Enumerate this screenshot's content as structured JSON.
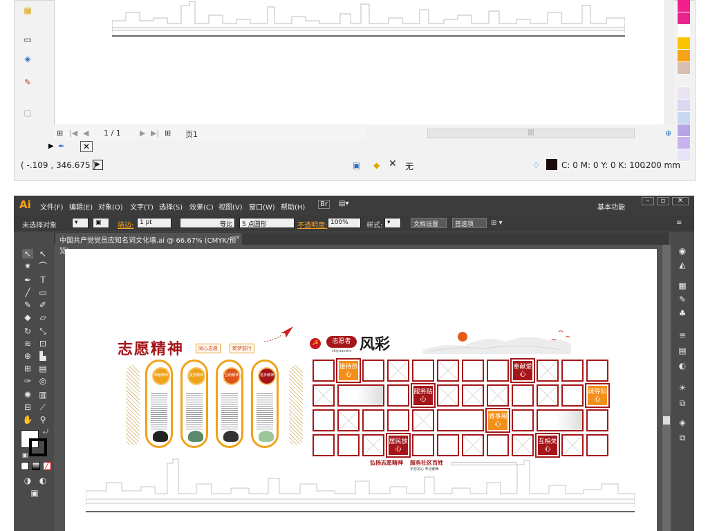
{
  "top_window": {
    "page_nav": {
      "page_counter": "1 / 1",
      "page_tab": "页1"
    },
    "status": {
      "coords": "( -.109 , 346.675 )",
      "fill_label": "无",
      "color_readout": "C: 0 M: 0 Y: 0 K: 100",
      "stroke_size": ".200 mm"
    },
    "scroll_thumb": "|||",
    "swatches": [
      "#f21f8a",
      "#e9238e",
      "#ffffff",
      "#fbc400",
      "#f7a21b",
      "#d8bfb1",
      "#f2f2f2",
      "#eae4f2",
      "#dcd6ee",
      "#c7d8f2",
      "#b6a6e6",
      "#c9b3ef",
      "#e8e4f6"
    ]
  },
  "ai_window": {
    "logo": "Ai",
    "menu": [
      "文件(F)",
      "编辑(E)",
      "对象(O)",
      "文字(T)",
      "选择(S)",
      "效果(C)",
      "视图(V)",
      "窗口(W)",
      "帮助(H)"
    ],
    "workspace": "基本功能",
    "control_bar": {
      "selection": "未选择对象",
      "stroke_label": "描边:",
      "stroke_weight": "1 pt",
      "stroke_style": "等比",
      "brush": "5 点圆形",
      "opacity_label": "不透明度:",
      "opacity": "100%",
      "style_label": "样式:",
      "doc_setup": "文档设置",
      "preferences": "首选项"
    },
    "document_tab": "中国共产党党员应知名词文化墙.ai @ 66.67% (CMYK/预览)"
  },
  "artwork": {
    "left_title": "志愿精神",
    "tags": [
      "同心志愿",
      "筑梦前行"
    ],
    "pillars": [
      {
        "heading": "奉献精神",
        "color": "#f0a21a"
      },
      {
        "heading": "友爱精神",
        "color": "#f0a21a"
      },
      {
        "heading": "互助精神",
        "color": "#e0541a"
      },
      {
        "heading": "进步精神",
        "color": "#a4161a"
      }
    ],
    "right_badge": "志愿者",
    "right_title": "风彩",
    "pinyin": "zhiyuanzhe",
    "grid_labels": [
      "接待热心",
      "奉献爱心",
      "服务贴心",
      "疏导知心",
      "做事用心",
      "居民放心",
      "互相关心"
    ],
    "slogan_left": "弘扬志愿精神",
    "slogan_right": "服务社区百姓",
    "slogan_small": "不忘初心 牢记使命"
  }
}
